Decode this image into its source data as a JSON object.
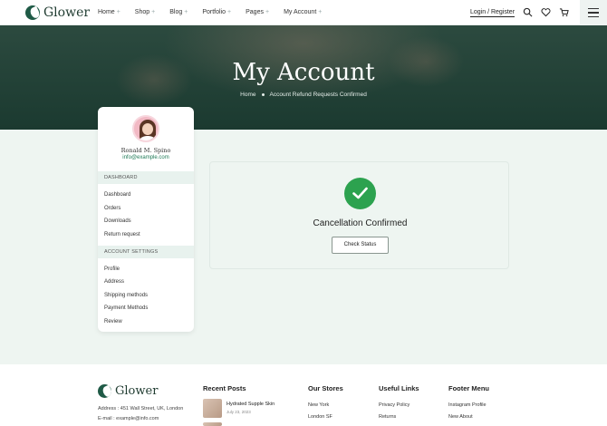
{
  "brand": {
    "name": "Glower"
  },
  "nav": {
    "items": [
      "Home",
      "Shop",
      "Blog",
      "Portfolio",
      "Pages",
      "My Account"
    ],
    "plus": "+",
    "login_label": "Login / Register"
  },
  "hero": {
    "title": "My Account",
    "breadcrumb": [
      "Home",
      "Account Refund Requests Confirmed"
    ]
  },
  "sidebar": {
    "user_name": "Ronald M. Spino",
    "user_email": "info@example.com",
    "dashboard_heading": "DASHBOARD",
    "dashboard_items": [
      "Dashboard",
      "Orders",
      "Downloads",
      "Return request"
    ],
    "settings_heading": "ACCOUNT SETTINGS",
    "settings_items": [
      "Profile",
      "Address",
      "Shipping methods",
      "Payment Methods",
      "Review"
    ]
  },
  "confirmation": {
    "message": "Cancellation Confirmed",
    "button_label": "Check Status"
  },
  "footer": {
    "address": "Address : 451 Wall Street, UK, London",
    "email": "E-mail : example@info.com",
    "recent_posts_heading": "Recent Posts",
    "post": {
      "title": "Hydrated Supple Skin",
      "date": "July 23, 2023"
    },
    "stores_heading": "Our Stores",
    "stores": [
      "New York",
      "London SF"
    ],
    "useful_heading": "Useful Links",
    "useful": [
      "Privacy Policy",
      "Returns"
    ],
    "menu_heading": "Footer Menu",
    "menu": [
      "Instagram Profile",
      "New About"
    ]
  },
  "colors": {
    "brand_green": "#1f5a46",
    "success": "#2ca24f",
    "email_green": "#1f7a57"
  }
}
